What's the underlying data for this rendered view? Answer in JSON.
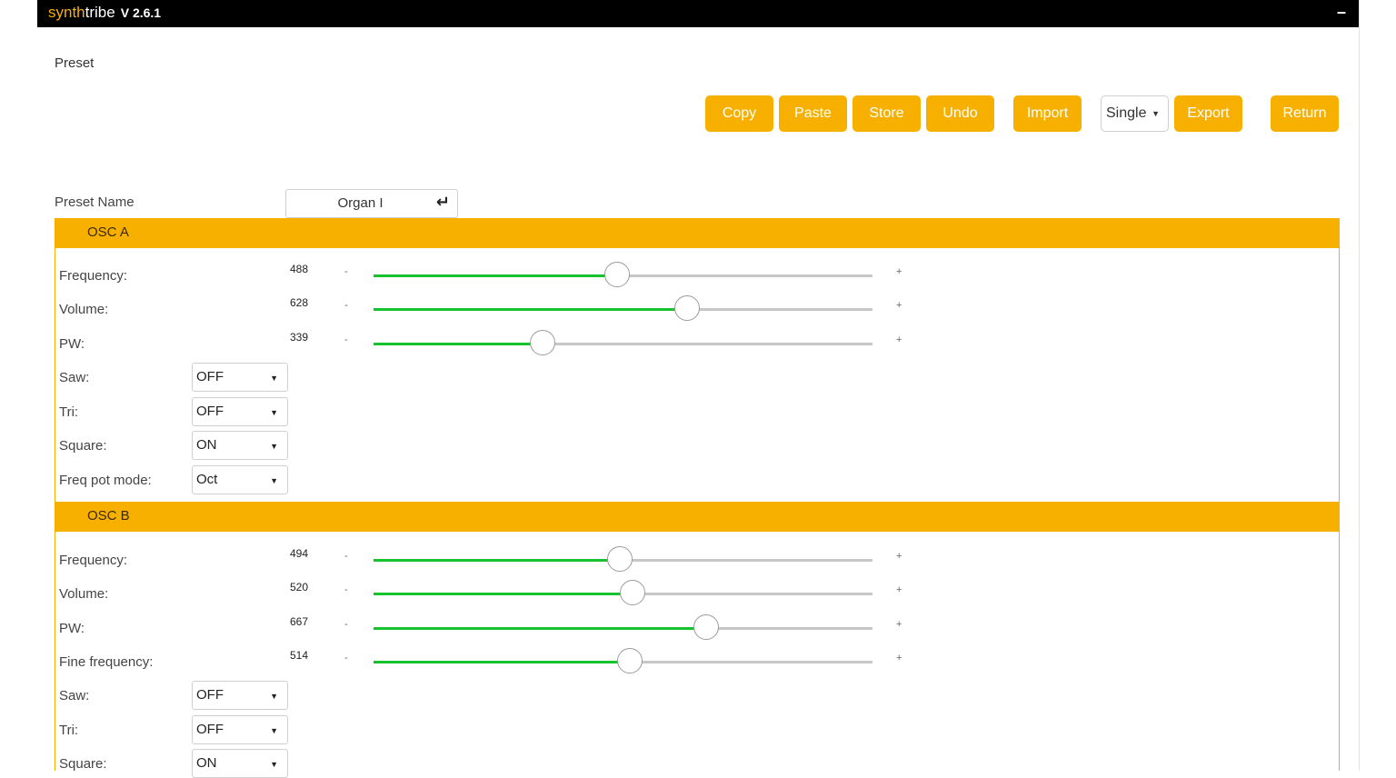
{
  "app": {
    "name_part1": "synth",
    "name_part2": "tribe",
    "version": "V 2.6.1",
    "minimize_glyph": "–"
  },
  "preset": {
    "label": "Preset",
    "buttons": {
      "copy": "Copy",
      "paste": "Paste",
      "store": "Store",
      "undo": "Undo",
      "import": "Import",
      "export": "Export",
      "return": "Return"
    },
    "mode_select": {
      "value": "Single",
      "caret": "▼"
    }
  },
  "preset_name": {
    "label": "Preset Name",
    "value": "Organ I",
    "enter_icon": "↵"
  },
  "slider_glyphs": {
    "minus": "-",
    "plus": "+"
  },
  "dropdown_caret": "▼",
  "colors": {
    "accent": "#f8b000",
    "slider_fill": "#18c12e",
    "track": "#c7c7c7",
    "titlebar": "#000000"
  },
  "osc_a": {
    "title": "OSC A",
    "sliders": [
      {
        "label": "Frequency:",
        "value": "488",
        "fraction": 0.488
      },
      {
        "label": "Volume:",
        "value": "628",
        "fraction": 0.628
      },
      {
        "label": "PW:",
        "value": "339",
        "fraction": 0.339
      }
    ],
    "selects": [
      {
        "label": "Saw:",
        "value": "OFF"
      },
      {
        "label": "Tri:",
        "value": "OFF"
      },
      {
        "label": "Square:",
        "value": "ON"
      },
      {
        "label": "Freq pot mode:",
        "value": "Oct"
      }
    ]
  },
  "osc_b": {
    "title": "OSC B",
    "sliders": [
      {
        "label": "Frequency:",
        "value": "494",
        "fraction": 0.494
      },
      {
        "label": "Volume:",
        "value": "520",
        "fraction": 0.52
      },
      {
        "label": "PW:",
        "value": "667",
        "fraction": 0.667
      },
      {
        "label": "Fine frequency:",
        "value": "514",
        "fraction": 0.514
      }
    ],
    "selects": [
      {
        "label": "Saw:",
        "value": "OFF"
      },
      {
        "label": "Tri:",
        "value": "OFF"
      },
      {
        "label": "Square:",
        "value": "ON"
      }
    ]
  }
}
